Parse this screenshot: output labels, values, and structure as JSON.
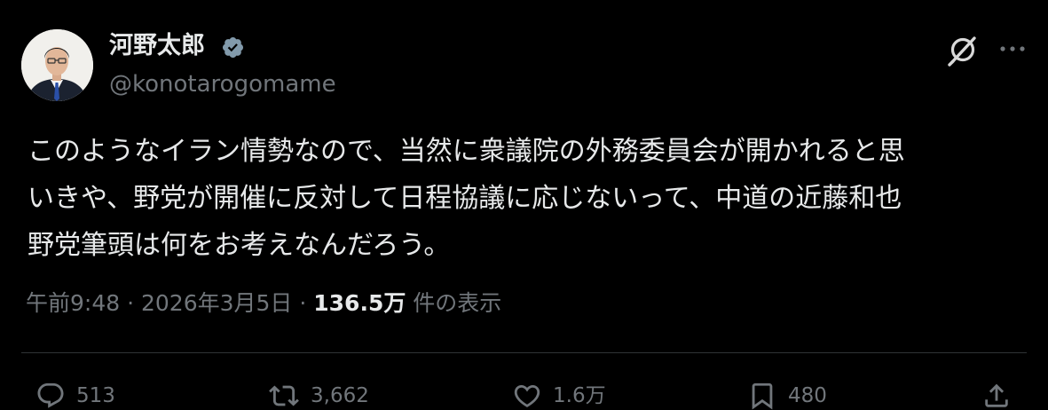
{
  "author": {
    "display_name": "河野太郎",
    "handle": "@konotarogomame",
    "verified": true
  },
  "tweet": {
    "lines": [
      "このようなイラン情勢なので、当然に衆議院の外務委員会が開かれると思",
      "いきや、野党が開催に反対して日程協議に応じないって、中道の近藤和也",
      "野党筆頭は何をお考えなんだろう。"
    ],
    "time": "午前9:48",
    "separator": " · ",
    "date": "2026年3月5日",
    "views": "136.5万",
    "views_label": " 件の表示"
  },
  "actions": {
    "replies": "513",
    "reposts": "3,662",
    "likes": "1.6万",
    "bookmarks": "480"
  },
  "icons": [
    "verified-badge-icon",
    "grok-icon",
    "more-icon",
    "reply-icon",
    "repost-icon",
    "like-icon",
    "bookmark-icon",
    "share-icon"
  ],
  "colors": {
    "background": "#000000",
    "text": "#e7e9ea",
    "secondary": "#71767b",
    "divider": "#2f3336"
  }
}
